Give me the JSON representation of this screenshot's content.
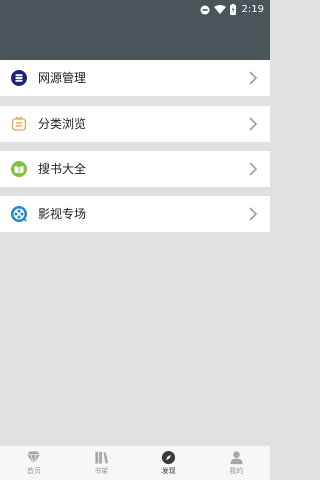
{
  "status_bar": {
    "time": "2:19"
  },
  "menu": {
    "items": [
      {
        "label": "网源管理",
        "icon": "database-icon"
      },
      {
        "label": "分类浏览",
        "icon": "category-icon"
      },
      {
        "label": "搜书大全",
        "icon": "book-search-icon"
      },
      {
        "label": "影视专场",
        "icon": "film-reel-icon"
      }
    ]
  },
  "bottom_nav": {
    "items": [
      {
        "label": "首页",
        "icon": "diamond-home-icon"
      },
      {
        "label": "书架",
        "icon": "bookshelf-icon"
      },
      {
        "label": "发现",
        "icon": "compass-icon"
      },
      {
        "label": "我的",
        "icon": "person-icon"
      }
    ],
    "active": "发现"
  },
  "colors": {
    "appbar": "#4a5559",
    "background": "#e0e0e0",
    "database_icon": "#1a237e",
    "category_icon": "#f0a050",
    "book_icon": "#7cc142",
    "film_icon": "#1e88c9"
  }
}
